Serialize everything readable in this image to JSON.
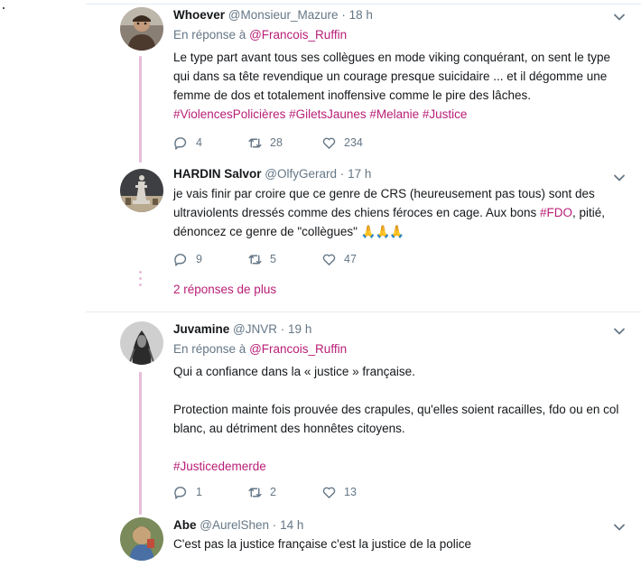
{
  "tweets": [
    {
      "name": "Whoever",
      "handle": "@Monsieur_Mazure",
      "time": "18 h",
      "reply_prefix": "En réponse à",
      "reply_to": "@Francois_Ruffin",
      "text_plain": "Le type part avant tous ses collègues en mode viking conquérant, on sent le type qui dans sa tête revendique un courage presque suicidaire ... et il dégomme une femme de dos et totalement inoffensive comme le pire des lâches.",
      "hashtags": "#ViolencesPolicières #GiletsJaunes #Melanie #Justice",
      "replies": "4",
      "retweets": "28",
      "likes": "234"
    },
    {
      "name": "HARDIN Salvor",
      "handle": "@OlfyGerard",
      "time": "17 h",
      "text_a": "je vais finir par croire que ce genre de CRS (heureusement pas tous) sont des ultraviolents dressés comme des chiens féroces en cage. Aux bons ",
      "text_hashtag": "#FDO",
      "text_b": ", pitié, dénoncez ce genre de \"collègues\" ",
      "emoji": "🙏🙏🙏",
      "replies": "9",
      "retweets": "5",
      "likes": "47"
    },
    {
      "name": "Juvamine",
      "handle": "@JNVR",
      "time": "19 h",
      "reply_prefix": "En réponse à",
      "reply_to": "@Francois_Ruffin",
      "line1": "Qui a confiance dans la « justice » française.",
      "line2": "Protection mainte fois prouvée des crapules, qu'elles soient racailles, fdo ou en col blanc, au détriment des honnêtes citoyens.",
      "hashtag": "#Justicedemerde",
      "replies": "1",
      "retweets": "2",
      "likes": "13"
    },
    {
      "name": "Abe",
      "handle": "@AurelShen",
      "time": "14 h",
      "text": "C'est pas la justice française c'est la justice de la police"
    }
  ],
  "more_replies": "2 réponses de plus",
  "separator": "·",
  "colors": {
    "accent": "#b81e76",
    "thread_line": "#e7bdda",
    "muted": "#657786"
  },
  "icons": [
    "reply-icon",
    "retweet-icon",
    "like-icon",
    "chevron-down-icon"
  ]
}
